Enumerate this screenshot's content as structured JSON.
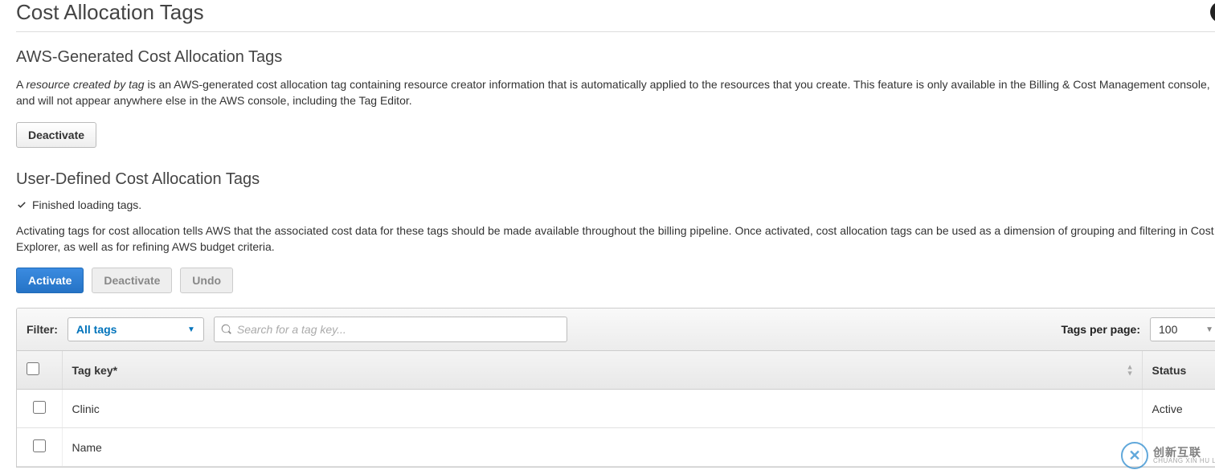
{
  "page": {
    "title": "Cost Allocation Tags"
  },
  "help": {
    "symbol": "?"
  },
  "aws_section": {
    "heading": "AWS-Generated Cost Allocation Tags",
    "desc_prefix": "A ",
    "desc_em": "resource created by tag",
    "desc_rest": " is an AWS-generated cost allocation tag containing resource creator information that is automatically applied to the resources that you create. This feature is only available in the Billing & Cost Management console, and will not appear anywhere else in the AWS console, including the Tag Editor.",
    "deactivate_label": "Deactivate"
  },
  "user_section": {
    "heading": "User-Defined Cost Allocation Tags",
    "status_line": "Finished loading tags.",
    "desc": "Activating tags for cost allocation tells AWS that the associated cost data for these tags should be made available throughout the billing pipeline. Once activated, cost allocation tags can be used as a dimension of grouping and filtering in Cost Explorer, as well as for refining AWS budget criteria.",
    "buttons": {
      "activate": "Activate",
      "deactivate": "Deactivate",
      "undo": "Undo"
    }
  },
  "toolbar": {
    "filter_label": "Filter:",
    "filter_value": "All tags",
    "search_placeholder": "Search for a tag key...",
    "per_page_label": "Tags per page:",
    "per_page_value": "100"
  },
  "table": {
    "headers": {
      "tag_key": "Tag key*",
      "status": "Status"
    },
    "rows": [
      {
        "key": "Clinic",
        "status": "Active"
      },
      {
        "key": "Name",
        "status": ""
      }
    ]
  },
  "watermark": {
    "zh": "创新互联",
    "en": "CHUANG XIN HU LIAN"
  }
}
